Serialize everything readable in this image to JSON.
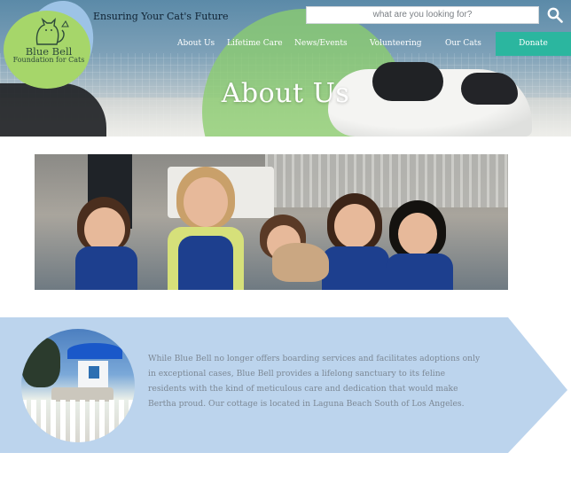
{
  "brand": {
    "name": "Blue Bell",
    "subtitle": "Foundation for Cats",
    "tagline": "Ensuring Your Cat's Future"
  },
  "search": {
    "placeholder": "what are you looking for?",
    "icon": "search-icon"
  },
  "nav": {
    "items": [
      {
        "label": "About Us"
      },
      {
        "label": "Lifetime Care"
      },
      {
        "label": "News/Events"
      },
      {
        "label": "Volunteering"
      },
      {
        "label": "Our Cats"
      }
    ],
    "donate_label": "Donate"
  },
  "hero": {
    "title": "About Us"
  },
  "about": {
    "paragraph": "While Blue Bell no longer offers boarding services and facilitates adoptions only in exceptional cases, Blue Bell provides a lifelong sanctuary to its feline residents with the kind of meticulous care and dedication that would make Bertha proud. Our cottage is located in Laguna Beach South of Los Angeles."
  },
  "colors": {
    "header_bg": "#5b8aa8",
    "donate_bg": "#2bb69f",
    "banner_bg": "#bcd4ed",
    "logo_green": "#a6d66a",
    "logo_blue": "#9dc3e6",
    "hero_overlay_green": "#8ccd6e"
  }
}
